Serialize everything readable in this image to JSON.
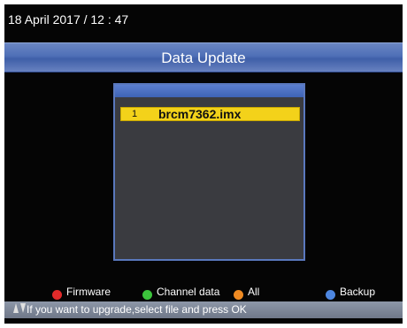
{
  "datetime": "18 April 2017 / 12 : 47",
  "title": "Data Update",
  "files": [
    {
      "index": "1",
      "name": "brcm7362.imx",
      "selected": true
    }
  ],
  "legend": {
    "firmware": {
      "label": "Firmware",
      "color": "#e02a2a"
    },
    "channel_data": {
      "label": "Channel data",
      "color": "#3cc43c"
    },
    "all": {
      "label": "All",
      "color": "#ef8a22"
    },
    "backup": {
      "label": "Backup",
      "color": "#4d86e0"
    }
  },
  "hint": {
    "icons": "up-down-arrow-icon",
    "text": "If you want to upgrade,select file and press OK"
  },
  "colors": {
    "title_bar": "#4e6fb6",
    "selection": "#f3d21a",
    "panel": "#3a3b40"
  }
}
